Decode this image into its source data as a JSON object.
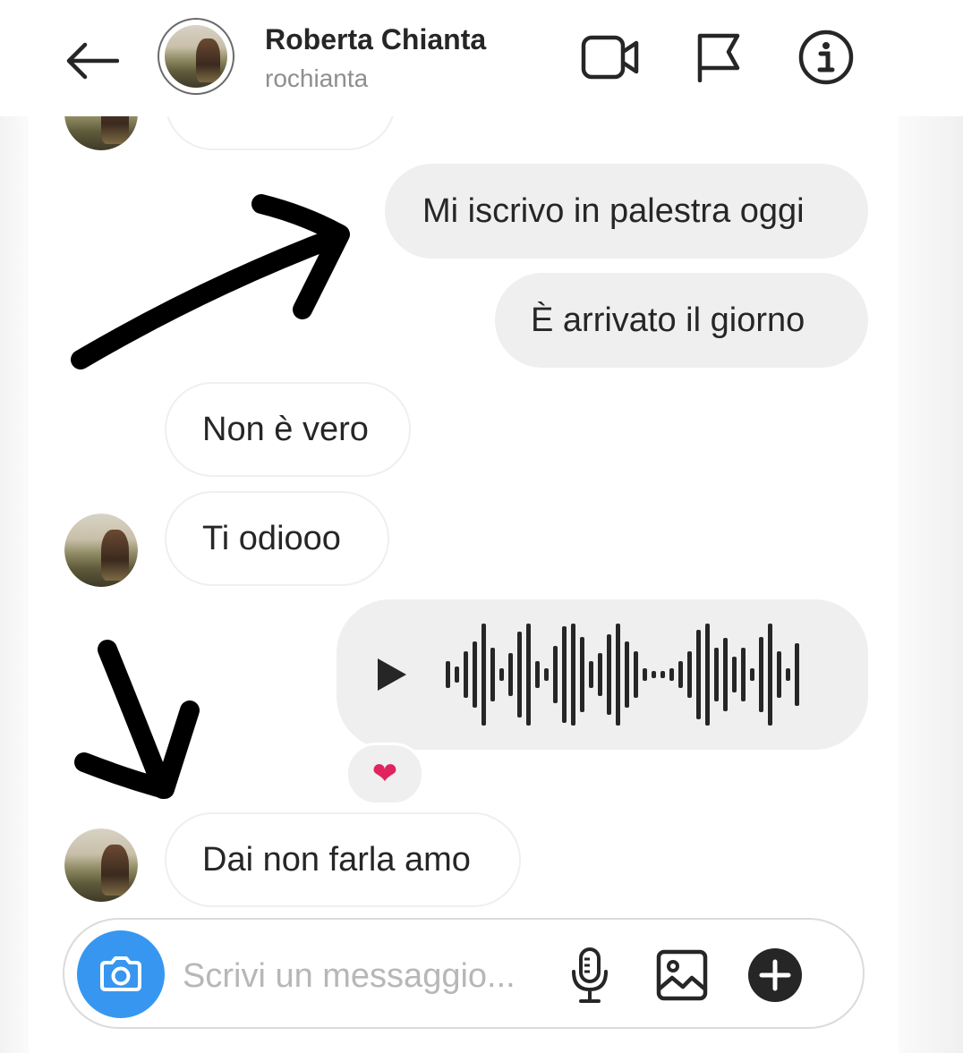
{
  "header": {
    "name": "Roberta Chianta",
    "username": "rochianta",
    "icons": [
      "back-arrow-icon",
      "video-call-icon",
      "flag-icon",
      "info-icon"
    ]
  },
  "messages": [
    {
      "side": "out",
      "text": "Mi iscrivo in palestra oggi"
    },
    {
      "side": "out",
      "text": "È  arrivato il giorno"
    },
    {
      "side": "in",
      "text": "Non è vero"
    },
    {
      "side": "in",
      "text": "Ti odiooo"
    },
    {
      "side": "out",
      "type": "voice"
    },
    {
      "side": "in",
      "text": "Dai non farla amo"
    }
  ],
  "reaction": {
    "emoji": "❤"
  },
  "composer": {
    "placeholder": "Scrivi un messaggio...",
    "icons": [
      "camera-icon",
      "microphone-icon",
      "gallery-icon",
      "plus-icon"
    ]
  },
  "colors": {
    "accent": "#3797f0",
    "bubble_out": "#efefef",
    "text": "#262626",
    "muted": "#8e8e8e",
    "heart": "#e0245e"
  }
}
